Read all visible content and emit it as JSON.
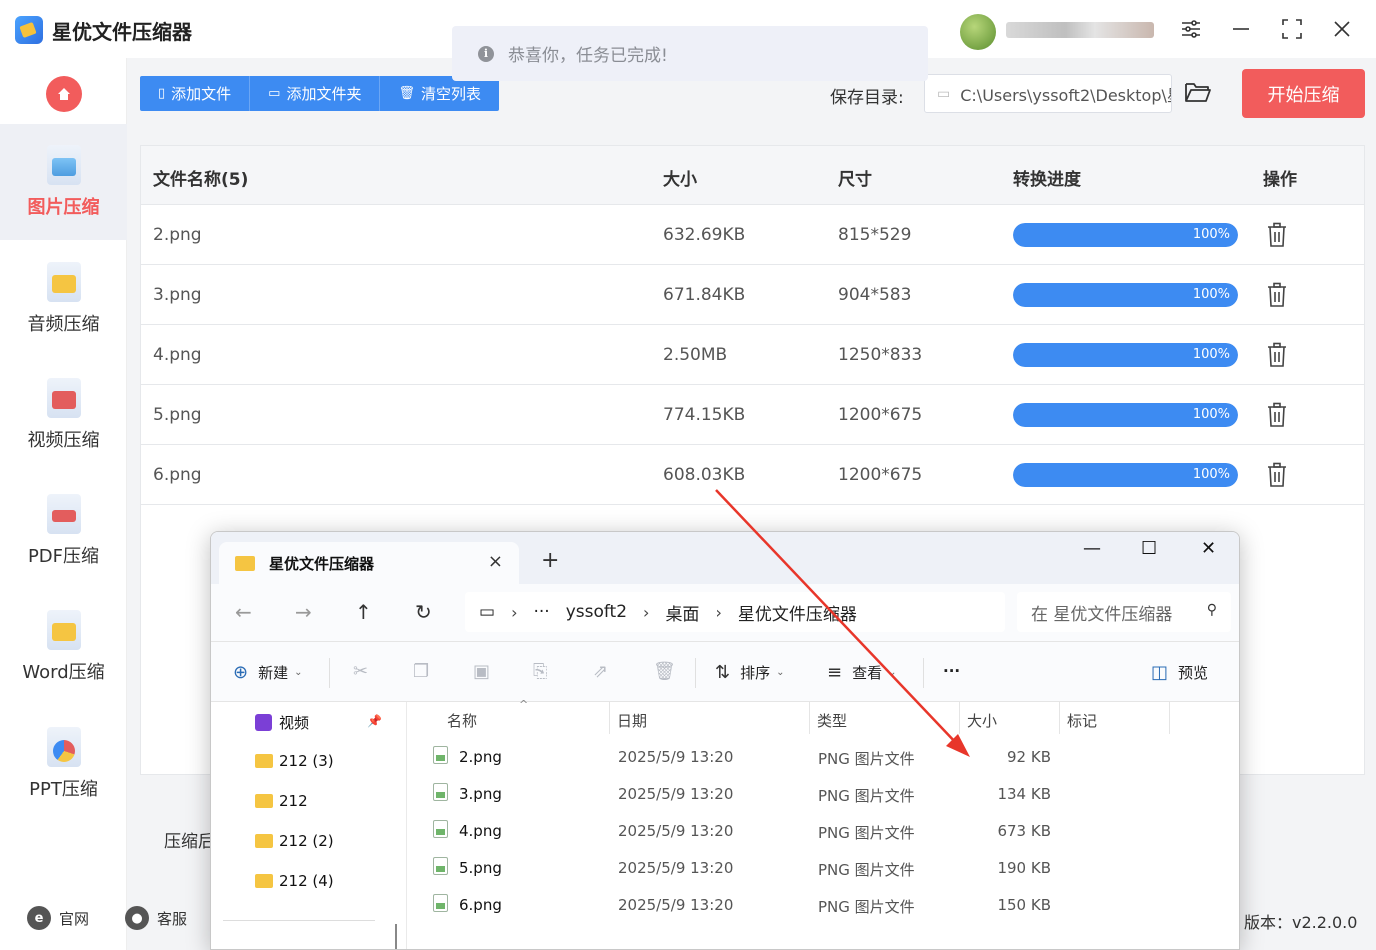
{
  "app": {
    "title": "星优文件压缩器",
    "user_name": "yssoft2",
    "window_controls": [
      "settings-icon",
      "minimize-icon",
      "maximize-icon",
      "close-icon"
    ]
  },
  "toast": {
    "message": "恭喜你，任务已完成!"
  },
  "sidebar": {
    "items": [
      {
        "label": "图片压缩",
        "icon": "image-icon",
        "active": true
      },
      {
        "label": "音频压缩",
        "icon": "audio-icon",
        "active": false
      },
      {
        "label": "视频压缩",
        "icon": "video-icon",
        "active": false
      },
      {
        "label": "PDF压缩",
        "icon": "pdf-icon",
        "active": false
      },
      {
        "label": "Word压缩",
        "icon": "word-icon",
        "active": false
      },
      {
        "label": "PPT压缩",
        "icon": "ppt-icon",
        "active": false
      }
    ],
    "footer": {
      "website": "官网",
      "service": "客服"
    }
  },
  "toolbar": {
    "add_file": "添加文件",
    "add_folder": "添加文件夹",
    "clear_list": "清空列表",
    "save_dir_label": "保存目录:",
    "save_dir_value": "C:\\Users\\yssoft2\\Desktop\\星",
    "start_button": "开始压缩"
  },
  "table": {
    "headers": {
      "name": "文件名称(5)",
      "size": "大小",
      "dimensions": "尺寸",
      "progress": "转换进度",
      "action": "操作"
    },
    "rows": [
      {
        "name": "2.png",
        "size": "632.69KB",
        "dimensions": "815*529",
        "progress": 1.0,
        "progress_text": "100%"
      },
      {
        "name": "3.png",
        "size": "671.84KB",
        "dimensions": "904*583",
        "progress": 1.0,
        "progress_text": "100%"
      },
      {
        "name": "4.png",
        "size": "2.50MB",
        "dimensions": "1250*833",
        "progress": 1.0,
        "progress_text": "100%"
      },
      {
        "name": "5.png",
        "size": "774.15KB",
        "dimensions": "1200*675",
        "progress": 1.0,
        "progress_text": "100%"
      },
      {
        "name": "6.png",
        "size": "608.03KB",
        "dimensions": "1200*675",
        "progress": 1.0,
        "progress_text": "100%"
      }
    ]
  },
  "footer": {
    "compress_label": "压缩后",
    "version": "版本：v2.2.0.0"
  },
  "explorer": {
    "tab_title": "星优文件压缩器",
    "breadcrumb": [
      "yssoft2",
      "桌面",
      "星优文件压缩器"
    ],
    "breadcrumb_more": "···",
    "search_placeholder": "在 星优文件压缩器",
    "commands": {
      "new": "新建",
      "sort": "排序",
      "view": "查看",
      "more": "···",
      "preview": "预览"
    },
    "sidebar": [
      {
        "label": "视频",
        "type": "video",
        "pinned": true
      },
      {
        "label": "212 (3)",
        "type": "folder"
      },
      {
        "label": "212",
        "type": "folder"
      },
      {
        "label": "212 (2)",
        "type": "folder"
      },
      {
        "label": "212 (4)",
        "type": "folder"
      }
    ],
    "columns": {
      "name": "名称",
      "date": "日期",
      "type": "类型",
      "size": "大小",
      "tag": "标记"
    },
    "files": [
      {
        "name": "2.png",
        "date": "2025/5/9 13:20",
        "type": "PNG 图片文件",
        "size": "92 KB"
      },
      {
        "name": "3.png",
        "date": "2025/5/9 13:20",
        "type": "PNG 图片文件",
        "size": "134 KB"
      },
      {
        "name": "4.png",
        "date": "2025/5/9 13:20",
        "type": "PNG 图片文件",
        "size": "673 KB"
      },
      {
        "name": "5.png",
        "date": "2025/5/9 13:20",
        "type": "PNG 图片文件",
        "size": "190 KB"
      },
      {
        "name": "6.png",
        "date": "2025/5/9 13:20",
        "type": "PNG 图片文件",
        "size": "150 KB"
      }
    ]
  },
  "colors": {
    "accent": "#3d8bf2",
    "danger": "#f25c5c",
    "annotation_arrow": "#e8362a"
  }
}
